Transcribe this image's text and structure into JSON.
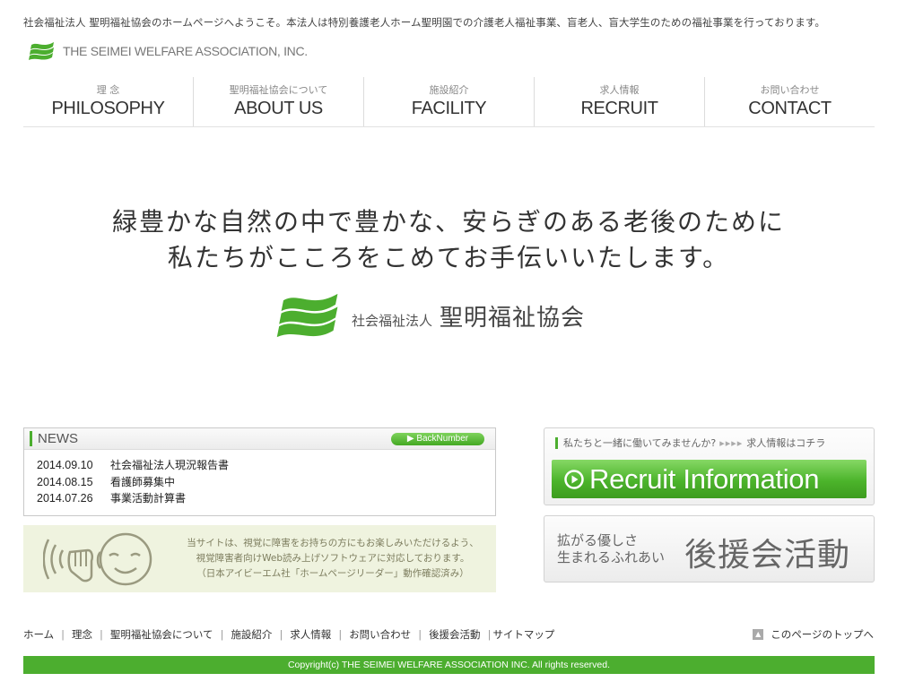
{
  "header": {
    "intro": "社会福祉法人 聖明福祉協会のホームページへようこそ。本法人は特別養護老人ホーム聖明園での介護老人福祉事業、盲老人、盲大学生のための福祉事業を行っております。",
    "brand": "THE SEIMEI WELFARE ASSOCIATION, INC.",
    "brand_color": "#4cae2f"
  },
  "nav": [
    {
      "jp": "理 念",
      "en": "PHILOSOPHY"
    },
    {
      "jp": "聖明福祉協会について",
      "en": "ABOUT US"
    },
    {
      "jp": "施設紹介",
      "en": "FACILITY"
    },
    {
      "jp": "求人情報",
      "en": "RECRUIT"
    },
    {
      "jp": "お問い合わせ",
      "en": "CONTACT"
    }
  ],
  "hero": {
    "line1": "緑豊かな自然の中で豊かな、安らぎのある老後のために",
    "line2": "私たちがこころをこめてお手伝いいたします。",
    "logo_small": "社会福祉法人",
    "logo_big": "聖明福祉協会"
  },
  "news": {
    "title": "NEWS",
    "back_number": "▶ BackNumber",
    "items": [
      {
        "date": "2014.09.10",
        "text": "社会福祉法人現況報告書"
      },
      {
        "date": "2014.08.15",
        "text": "看護師募集中"
      },
      {
        "date": "2014.07.26",
        "text": "事業活動計算書"
      }
    ]
  },
  "accessibility": {
    "line1": "当サイトは、視覚に障害をお持ちの方にもお楽しみいただけるよう、",
    "line2": "視覚障害者向けWeb読み上げソフトウェアに対応しております。",
    "line3": "（日本アイビーエム社「ホームページリーダー」動作確認済み）"
  },
  "recruit": {
    "prompt": "私たちと一緒に働いてみませんか?",
    "arrows": "▸▸▸▸",
    "link": "求人情報はコチラ",
    "button": "Recruit Information"
  },
  "support": {
    "line1": "拡がる優しさ",
    "line2": "生まれるふれあい",
    "title": "後援会活動"
  },
  "footer": {
    "links": [
      "ホーム",
      "理念",
      "聖明福祉協会について",
      "施設紹介",
      "求人情報",
      "お問い合わせ",
      "後援会活動",
      "サイトマップ"
    ],
    "to_top": "このページのトップへ",
    "copyright": "Copyright(c) THE SEIMEI WELFARE ASSOCIATION INC. All rights reserved."
  }
}
